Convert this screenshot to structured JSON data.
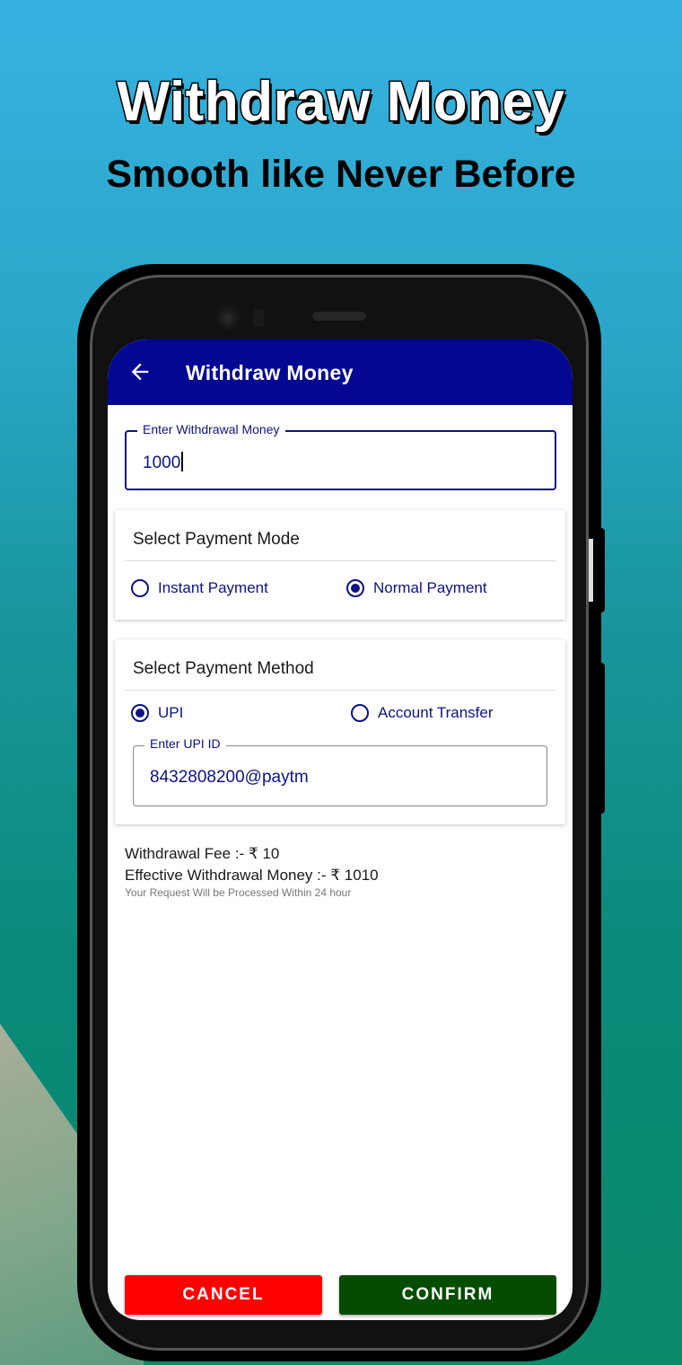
{
  "promo": {
    "title": "Withdraw Money",
    "subtitle": "Smooth like Never Before"
  },
  "appbar": {
    "title": "Withdraw Money",
    "back_icon": "arrow-left-icon"
  },
  "amount_field": {
    "label": "Enter Withdrawal Money",
    "value": "1000"
  },
  "payment_mode": {
    "title": "Select Payment Mode",
    "options": [
      {
        "label": "Instant Payment",
        "selected": false
      },
      {
        "label": "Normal Payment",
        "selected": true
      }
    ]
  },
  "payment_method": {
    "title": "Select Payment Method",
    "options": [
      {
        "label": "UPI",
        "selected": true
      },
      {
        "label": "Account Transfer",
        "selected": false
      }
    ],
    "upi_field": {
      "label": "Enter UPI ID",
      "value": "8432808200@paytm"
    }
  },
  "summary": {
    "fee": "Withdrawal Fee :- ₹ 10",
    "effective": "Effective Withdrawal Money :- ₹ 1010",
    "note": "Your Request Will be Processed Within 24 hour"
  },
  "buttons": {
    "cancel": "CANCEL",
    "confirm": "CONFIRM"
  },
  "colors": {
    "appbar": "#030893",
    "accent": "#0d1480",
    "cancel": "#ff0000",
    "confirm": "#044d00"
  }
}
